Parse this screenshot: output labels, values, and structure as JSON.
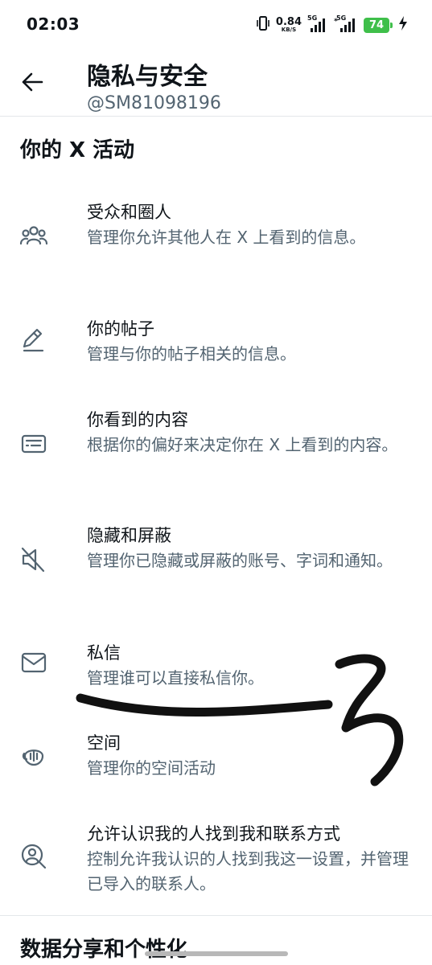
{
  "status_bar": {
    "time": "02:03",
    "net_speed_value": "0.84",
    "net_speed_unit": "KB/S",
    "signal1_label": "5G",
    "signal2_label": "5G",
    "battery_level": "74"
  },
  "header": {
    "title": "隐私与安全",
    "username": "@SM81098196"
  },
  "section": {
    "title": "你的 X 活动"
  },
  "items": [
    {
      "label": "受众和圈人",
      "description": "管理你允许其他人在 X 上看到的信息。",
      "icon": "audience-icon"
    },
    {
      "label": "你的帖子",
      "description": "管理与你的帖子相关的信息。",
      "icon": "pencil-icon"
    },
    {
      "label": "你看到的内容",
      "description": "根据你的偏好来决定你在 X 上看到的内容。",
      "icon": "content-icon"
    },
    {
      "label": "隐藏和屏蔽",
      "description": "管理你已隐藏或屏蔽的账号、字词和通知。",
      "icon": "mute-icon"
    },
    {
      "label": "私信",
      "description": "管理谁可以直接私信你。",
      "icon": "envelope-icon"
    },
    {
      "label": "空间",
      "description": "管理你的空间活动",
      "icon": "spaces-icon"
    },
    {
      "label": "允许认识我的人找到我和联系方式",
      "description": "控制允许我认识的人找到我这一设置，并管理已导入的联系人。",
      "icon": "discoverability-icon"
    }
  ],
  "next_section": {
    "title": "数据分享和个性化"
  },
  "colors": {
    "primary_text": "#0f1419",
    "secondary_text": "#536471",
    "divider": "#e4e7ea",
    "battery": "#3fbf4a",
    "scribble": "#111111"
  }
}
